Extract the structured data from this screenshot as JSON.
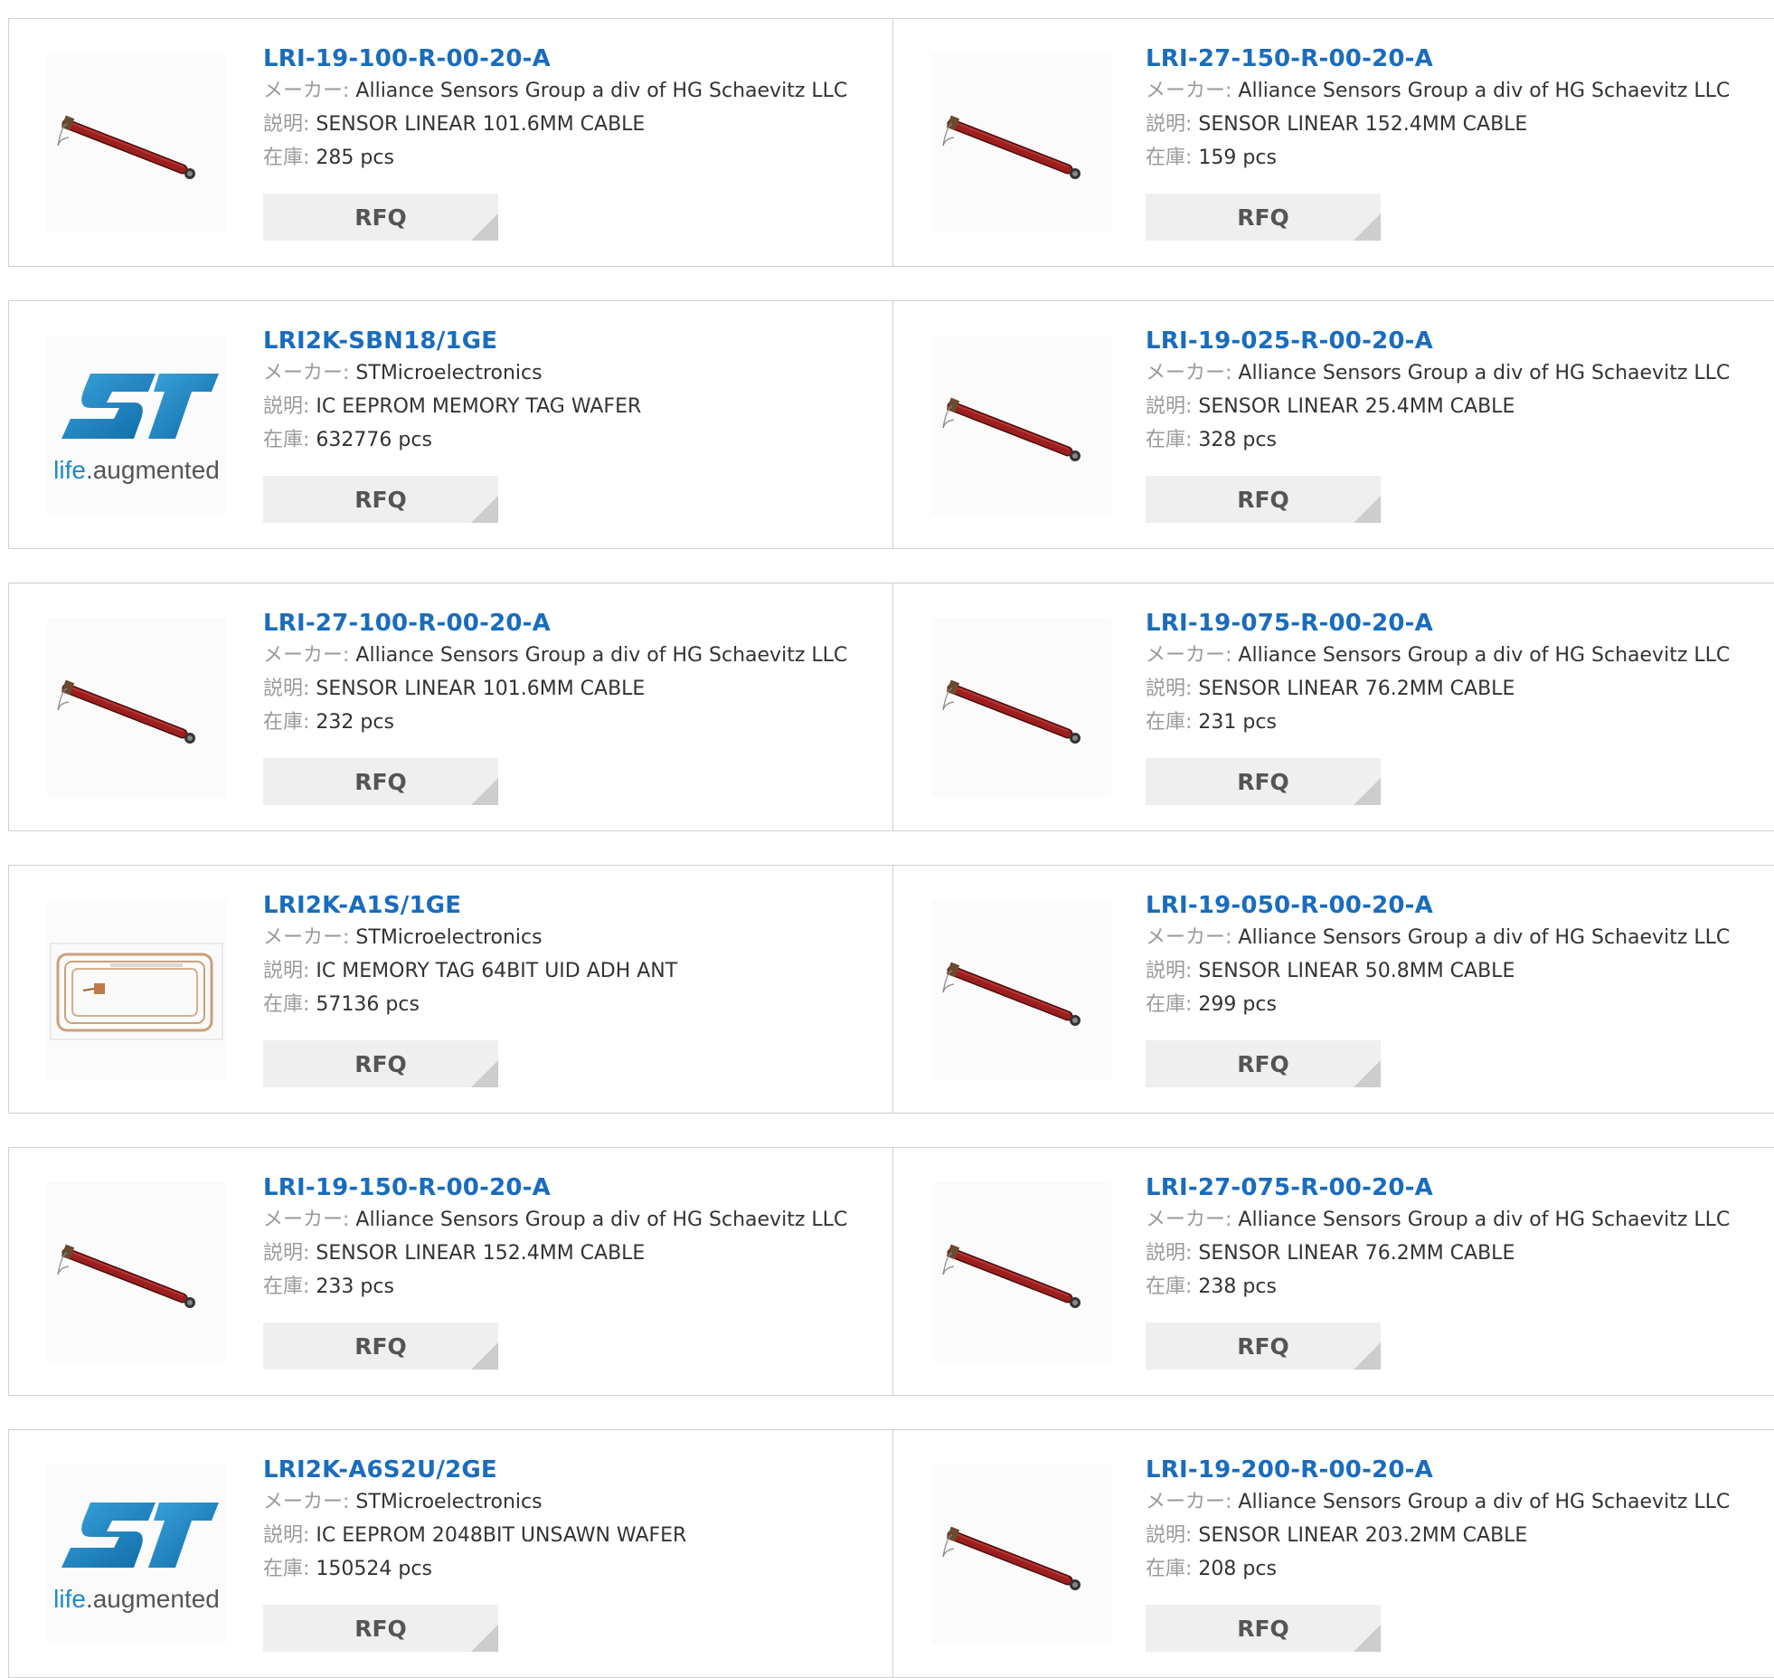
{
  "labels": {
    "maker": "メーカー:",
    "desc": "説明:",
    "stock": "在庫:",
    "rfq": "RFQ"
  },
  "products": [
    {
      "pn": "LRI-19-100-R-00-20-A",
      "maker": "Alliance Sensors Group a div of HG Schaevitz LLC",
      "desc": "SENSOR LINEAR 101.6MM CABLE",
      "stock": "285 pcs",
      "image": "sensor-rod"
    },
    {
      "pn": "LRI-27-150-R-00-20-A",
      "maker": "Alliance Sensors Group a div of HG Schaevitz LLC",
      "desc": "SENSOR LINEAR 152.4MM CABLE",
      "stock": "159 pcs",
      "image": "sensor-rod"
    },
    {
      "pn": "LRI2K-SBN18/1GE",
      "maker": "STMicroelectronics",
      "desc": "IC EEPROM MEMORY TAG WAFER",
      "stock": "632776 pcs",
      "image": "st-logo"
    },
    {
      "pn": "LRI-19-025-R-00-20-A",
      "maker": "Alliance Sensors Group a div of HG Schaevitz LLC",
      "desc": "SENSOR LINEAR 25.4MM CABLE",
      "stock": "328 pcs",
      "image": "sensor-rod"
    },
    {
      "pn": "LRI-27-100-R-00-20-A",
      "maker": "Alliance Sensors Group a div of HG Schaevitz LLC",
      "desc": "SENSOR LINEAR 101.6MM CABLE",
      "stock": "232 pcs",
      "image": "sensor-rod"
    },
    {
      "pn": "LRI-19-075-R-00-20-A",
      "maker": "Alliance Sensors Group a div of HG Schaevitz LLC",
      "desc": "SENSOR LINEAR 76.2MM CABLE",
      "stock": "231 pcs",
      "image": "sensor-rod"
    },
    {
      "pn": "LRI2K-A1S/1GE",
      "maker": "STMicroelectronics",
      "desc": "IC MEMORY TAG 64BIT UID ADH ANT",
      "stock": "57136 pcs",
      "image": "rfid-tag"
    },
    {
      "pn": "LRI-19-050-R-00-20-A",
      "maker": "Alliance Sensors Group a div of HG Schaevitz LLC",
      "desc": "SENSOR LINEAR 50.8MM CABLE",
      "stock": "299 pcs",
      "image": "sensor-rod"
    },
    {
      "pn": "LRI-19-150-R-00-20-A",
      "maker": "Alliance Sensors Group a div of HG Schaevitz LLC",
      "desc": "SENSOR LINEAR 152.4MM CABLE",
      "stock": "233 pcs",
      "image": "sensor-rod"
    },
    {
      "pn": "LRI-27-075-R-00-20-A",
      "maker": "Alliance Sensors Group a div of HG Schaevitz LLC",
      "desc": "SENSOR LINEAR 76.2MM CABLE",
      "stock": "238 pcs",
      "image": "sensor-rod"
    },
    {
      "pn": "LRI2K-A6S2U/2GE",
      "maker": "STMicroelectronics",
      "desc": "IC EEPROM 2048BIT UNSAWN WAFER",
      "stock": "150524 pcs",
      "image": "st-logo"
    },
    {
      "pn": "LRI-19-200-R-00-20-A",
      "maker": "Alliance Sensors Group a div of HG Schaevitz LLC",
      "desc": "SENSOR LINEAR 203.2MM CABLE",
      "stock": "208 pcs",
      "image": "sensor-rod"
    }
  ],
  "logo_text": {
    "st_tagline_1": "life",
    "st_tagline_2": ".augmented"
  },
  "colors": {
    "part_link": "#1a6cbd",
    "label_grey": "#9a9a9a",
    "rod": "#8b1a1a",
    "st_blue": "#1e8ac4"
  }
}
